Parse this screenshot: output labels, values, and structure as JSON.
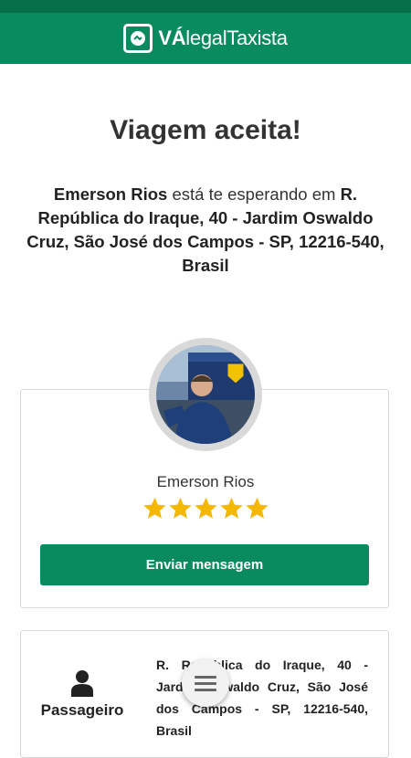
{
  "app": {
    "logo_brand": "VÁ",
    "logo_rest": "legalTaxista"
  },
  "main": {
    "title": "Viagem aceita!",
    "message": {
      "driver_name": "Emerson Rios",
      "waiting_text": " está te esperando em ",
      "address": "R. República do Iraque, 40 - Jardim Oswaldo Cruz, São José dos Campos - SP, 12216-540, Brasil"
    }
  },
  "driver_card": {
    "name": "Emerson Rios",
    "rating": 5,
    "rating_max": 5,
    "star_color": "#f5b800",
    "send_message_label": "Enviar mensagem"
  },
  "passenger_card": {
    "label": "Passageiro",
    "address": "R. República do Iraque, 40 - Jardim Oswaldo Cruz, São José dos Campos - SP, 12216-540, Brasil"
  },
  "colors": {
    "brand_green": "#0a8a5f",
    "status_bar": "#076e4a"
  }
}
